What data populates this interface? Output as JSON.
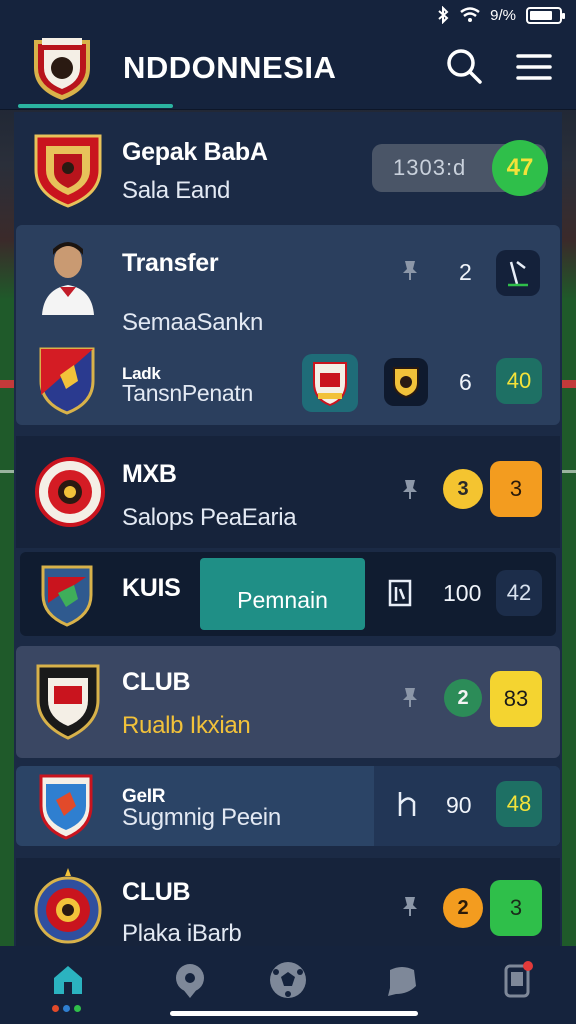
{
  "status_bar": {
    "battery_text": "9/%",
    "icons": [
      "bluetooth-icon",
      "wifi-icon",
      "battery-icon"
    ]
  },
  "header": {
    "title": "NDDONNESIA",
    "icons": [
      "club-logo",
      "search-icon",
      "menu-icon"
    ]
  },
  "rows": [
    {
      "title": "Gepak BabA",
      "subtitle": "Sala Eand",
      "score_text": "1303:d",
      "badge": "47",
      "colors": {
        "badge": "#2fbf4a"
      }
    },
    {
      "title": "Transfer",
      "subtitle": "SemaaSankn",
      "count": "2",
      "sub_title": "Ladk",
      "sub_subtitle": "TansnPenatn",
      "sub_count": "6",
      "sub_badge": "40"
    },
    {
      "title": "MXB",
      "subtitle": "Salops PeaEaria",
      "badge_left": "3",
      "badge_right": "3"
    },
    {
      "title": "KUIS",
      "action": "Pemnain",
      "count": "100",
      "badge": "42"
    },
    {
      "title": "CLUB",
      "subtitle": "Rualb Ikxian",
      "badge_left": "2",
      "badge_right": "83"
    },
    {
      "title": "GeIR",
      "subtitle": "Sugmnig Peein",
      "count": "90",
      "badge": "48"
    },
    {
      "title": "CLUB",
      "subtitle": "Plaka iBarb",
      "badge_left": "2",
      "badge_right": "3"
    }
  ],
  "bottom_nav": {
    "items": [
      "home-icon",
      "pin-icon",
      "ball-icon",
      "chat-icon",
      "phone-icon"
    ]
  },
  "colors": {
    "background": "#1b2a45",
    "header": "#15233d",
    "accent": "#2bb3a0",
    "green": "#2fbf4a",
    "yellow": "#f4c430",
    "orange": "#f39c1f",
    "teal_button": "#1f8f86"
  }
}
